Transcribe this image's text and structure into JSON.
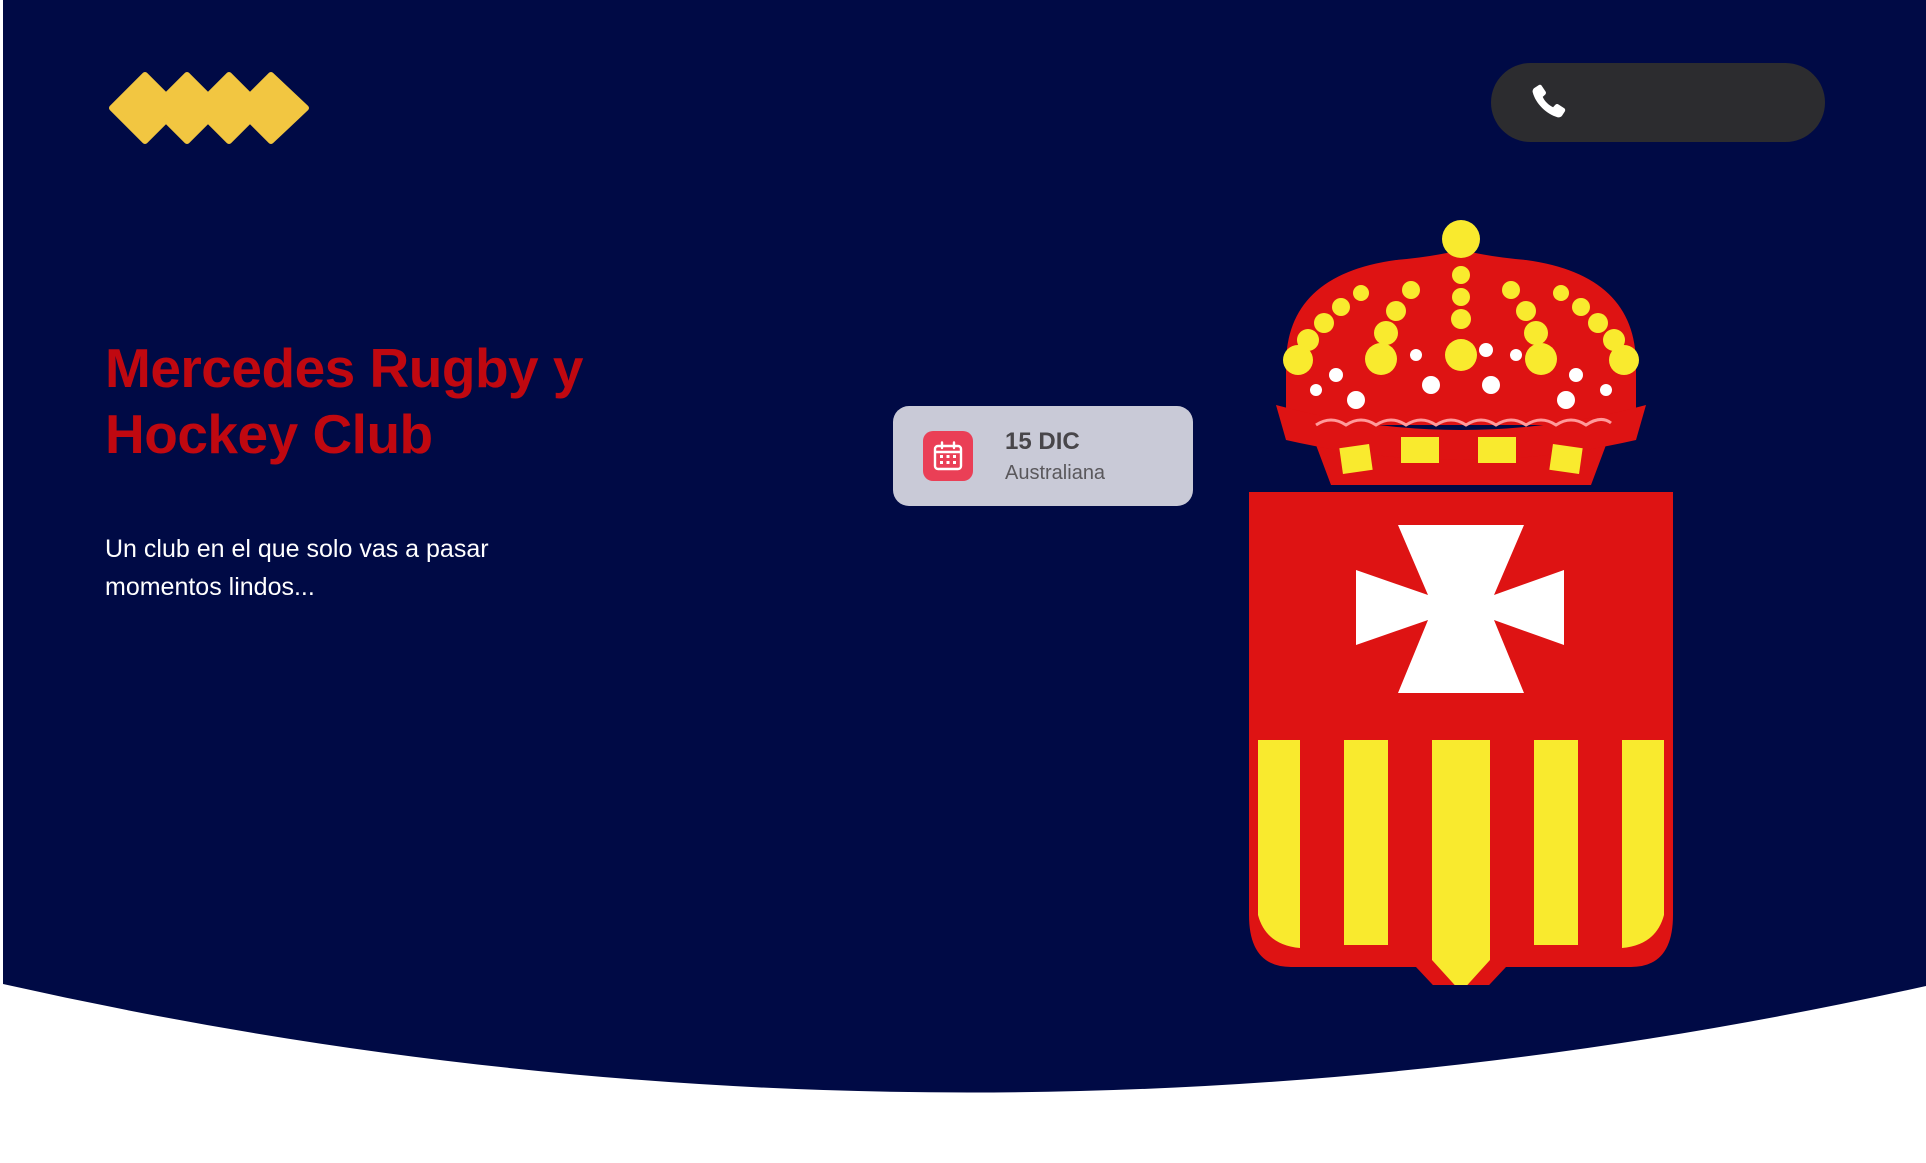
{
  "colors": {
    "hero_background": "#000a45",
    "accent_yellow": "#f2c641",
    "title_red": "#c00810",
    "phone_pill": "#2c2c2f",
    "event_card": "#c9cad7",
    "calendar_badge": "#ea3f56",
    "crest_red": "#de1313",
    "crest_yellow": "#f9ea2e"
  },
  "header": {
    "logo_icon": "diamond-wave-logo-icon",
    "phone_icon": "phone-icon",
    "phone_number": ""
  },
  "hero": {
    "title_line1": "Mercedes Rugby y",
    "title_line2": "Hockey Club",
    "subtitle_line1": "Un club en el que solo vas a pasar",
    "subtitle_line2": "momentos lindos..."
  },
  "event_card": {
    "icon": "calendar-icon",
    "date": "15 DIC",
    "name": "Australiana"
  },
  "crest": {
    "icon": "club-crest-icon"
  }
}
